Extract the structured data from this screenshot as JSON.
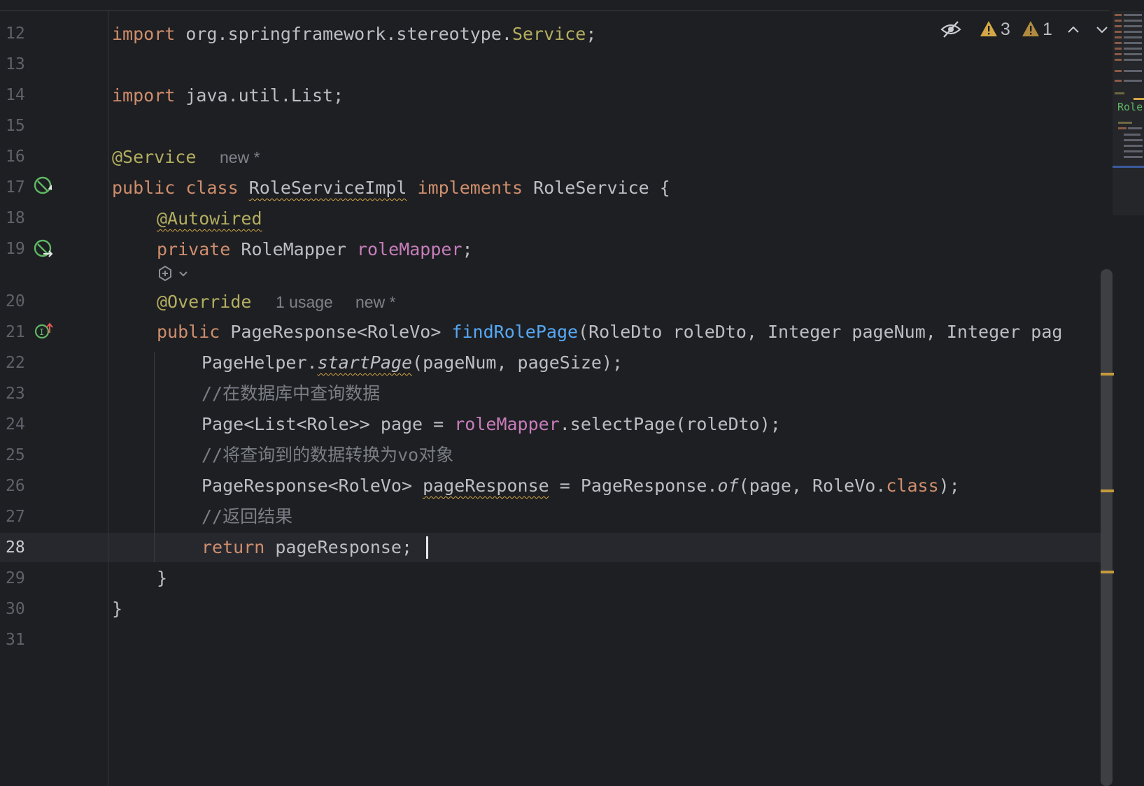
{
  "editor": {
    "line_numbers": [
      "12",
      "13",
      "14",
      "15",
      "16",
      "17",
      "18",
      "19",
      "20",
      "21",
      "22",
      "23",
      "24",
      "25",
      "26",
      "27",
      "28",
      "29",
      "30",
      "31"
    ],
    "current_line": "28",
    "lines": {
      "l12": {
        "kw": "import",
        "t1": " org.springframework.stereotype.",
        "ann": "Service",
        "t2": ";"
      },
      "l14": {
        "kw": "import",
        "t1": " java.util.List;"
      },
      "l16": {
        "ann": "@Service",
        "hint": "new *"
      },
      "l17": {
        "kw1": "public",
        "kw2": "class",
        "name": "RoleServiceImpl",
        "kw3": "implements",
        "t1": " RoleService {"
      },
      "l18": {
        "ann": "@Autowired"
      },
      "l19": {
        "kw": "private",
        "t1": " RoleMapper ",
        "field": "roleMapper",
        "t2": ";"
      },
      "l20": {
        "ann": "@Override",
        "hint1": "1 usage",
        "hint2": "new *"
      },
      "l21": {
        "kw": "public",
        "t1": " PageResponse<RoleVo> ",
        "fn": "findRolePage",
        "t2": "(RoleDto roleDto, Integer pageNum, Integer pag"
      },
      "l22": {
        "t1": "PageHelper.",
        "method": "startPage",
        "t2": "(pageNum, pageSize);"
      },
      "l23": {
        "comment": "//在数据库中查询数据"
      },
      "l24": {
        "t1": "Page<List<Role>> page = ",
        "field": "roleMapper",
        "t2": ".selectPage(roleDto);"
      },
      "l25": {
        "comment": "//将查询到的数据转换为vo对象"
      },
      "l26": {
        "t1": "PageResponse<RoleVo> ",
        "var": "pageResponse",
        "t2": " = PageResponse.",
        "method": "of",
        "t3": "(page, RoleVo.",
        "kw": "class",
        "t4": ");"
      },
      "l27": {
        "comment": "//返回结果"
      },
      "l28": {
        "kw": "return",
        "t1": " pageResponse;"
      },
      "l29": {
        "t1": "}"
      },
      "l30": {
        "t1": "}"
      }
    }
  },
  "inspections": {
    "warnings_count": "3",
    "weak_warnings_count": "1"
  },
  "minimap": {
    "label": "Role"
  },
  "colors": {
    "background": "#1e1f22",
    "keyword": "#cf8e6d",
    "annotation": "#b3ae60",
    "field": "#c77dbb",
    "function": "#56a8f5",
    "comment": "#7a7e85",
    "warning": "#d4a847"
  },
  "icons": [
    "implemented-gutter-icon",
    "injected-gutter-icon",
    "ai-assistant-icon",
    "implements-method-gutter-icon",
    "hide-inspections-icon",
    "warning-icon",
    "weak-warning-icon",
    "chevron-up-icon",
    "chevron-down-icon"
  ]
}
